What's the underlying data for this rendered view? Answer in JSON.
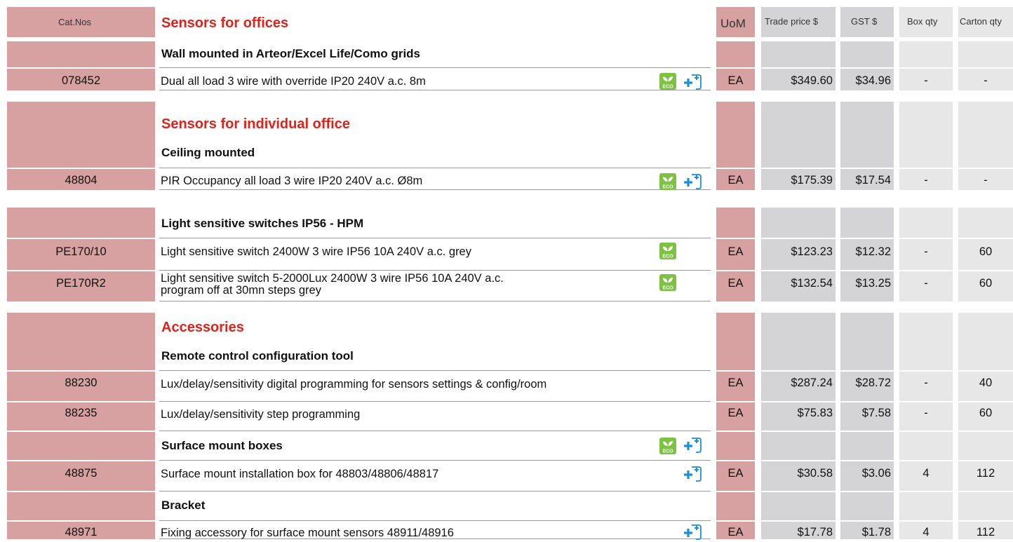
{
  "header": {
    "catnos": "Cat.Nos",
    "title": "Sensors for offices",
    "uom": "UoM",
    "trade": "Trade price $",
    "gst": "GST $",
    "box": "Box qty",
    "carton": "Carton qty"
  },
  "s1": {
    "subtitle": "Wall mounted in Arteor/Excel Life/Como grids",
    "rows": [
      {
        "cat": "078452",
        "desc": "Dual all load 3 wire with override IP20 240V a.c. 8m",
        "uom": "EA",
        "trade": "$349.60",
        "gst": "$34.96",
        "box": "-",
        "carton": "-"
      }
    ]
  },
  "s2": {
    "title": "Sensors for individual office",
    "subtitle": "Ceiling mounted",
    "rows": [
      {
        "cat": "48804",
        "desc": "PIR Occupancy all load 3 wire IP20 240V a.c. Ø8m",
        "uom": "EA",
        "trade": "$175.39",
        "gst": "$17.54",
        "box": "-",
        "carton": "-"
      }
    ]
  },
  "s3": {
    "subtitle": "Light sensitive switches IP56 - HPM",
    "rows": [
      {
        "cat": "PE170/10",
        "desc": "Light sensitive switch 2400W 3 wire IP56 10A 240V a.c. grey",
        "uom": "EA",
        "trade": "$123.23",
        "gst": "$12.32",
        "box": "-",
        "carton": "60"
      },
      {
        "cat": "PE170R2",
        "desc1": "Light sensitive switch 5-2000Lux 2400W 3 wire IP56 10A 240V a.c.",
        "desc2": "program off at 30mn steps grey",
        "uom": "EA",
        "trade": "$132.54",
        "gst": "$13.25",
        "box": "-",
        "carton": "60"
      }
    ]
  },
  "s4": {
    "title": "Accessories",
    "sub1": "Remote control configuration tool",
    "sub2": "Surface mount boxes",
    "sub3": "Bracket",
    "rows": [
      {
        "cat": "88230",
        "desc": "Lux/delay/sensitivity digital programming for sensors settings & config/room",
        "uom": "EA",
        "trade": "$287.24",
        "gst": "$28.72",
        "box": "-",
        "carton": "40"
      },
      {
        "cat": "88235",
        "desc": "Lux/delay/sensitivity step programming",
        "uom": "EA",
        "trade": "$75.83",
        "gst": "$7.58",
        "box": "-",
        "carton": "60"
      },
      {
        "cat": "48875",
        "desc": "Surface mount installation box for 48803/48806/48817",
        "uom": "EA",
        "trade": "$30.58",
        "gst": "$3.06",
        "box": "4",
        "carton": "112"
      },
      {
        "cat": "48971",
        "desc": "Fixing accessory for surface mount sensors 48911/48916",
        "uom": "EA",
        "trade": "$17.78",
        "gst": "$1.78",
        "box": "4",
        "carton": "112"
      }
    ]
  },
  "icons": {
    "eco": "eco-leaf-icon",
    "plus": "plus-new-product-icon",
    "eco_label": "ECO",
    "eco_color": "#7dc242",
    "plus_color": "#1d8fd6"
  },
  "colors": {
    "accent_red": "#e0221b",
    "pink": "#d6a1a0",
    "gray": "#d4d4d6",
    "light_gray": "#e7e7e8"
  }
}
